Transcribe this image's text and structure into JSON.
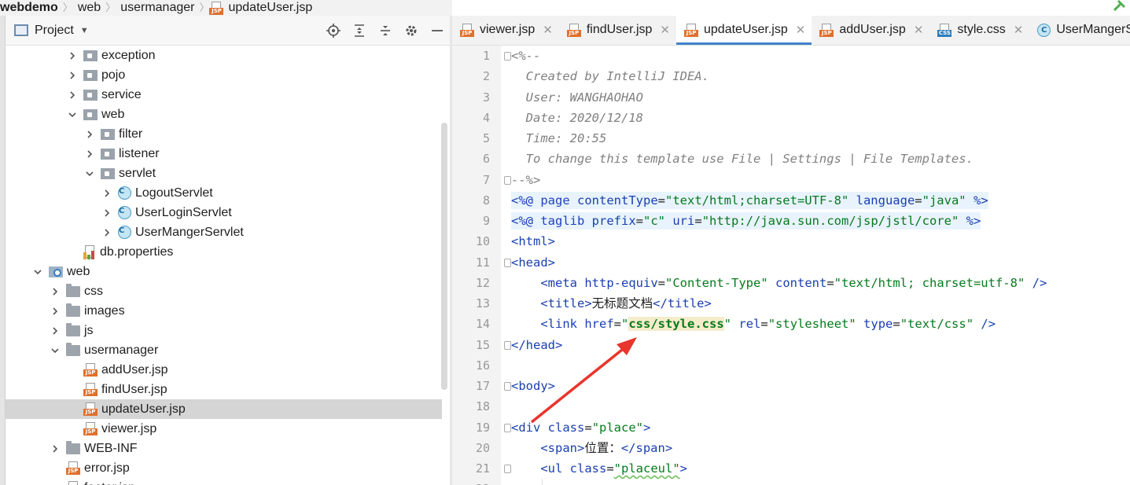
{
  "breadcrumb": [
    "webdemo",
    "web",
    "usermanager",
    "updateUser.jsp"
  ],
  "breadcrumb_file_icon": "jsp-file-icon",
  "project_panel": {
    "title": "Project",
    "tools": [
      "locate-icon",
      "expand-all-icon",
      "collapse-all-icon",
      "settings-gear-icon",
      "minimize-icon"
    ]
  },
  "tree": [
    {
      "label": "exception",
      "indent": 3,
      "icon": "package",
      "arrow": "right"
    },
    {
      "label": "pojo",
      "indent": 3,
      "icon": "package",
      "arrow": "right"
    },
    {
      "label": "service",
      "indent": 3,
      "icon": "package",
      "arrow": "right"
    },
    {
      "label": "web",
      "indent": 3,
      "icon": "package",
      "arrow": "down"
    },
    {
      "label": "filter",
      "indent": 4,
      "icon": "package",
      "arrow": "right"
    },
    {
      "label": "listener",
      "indent": 4,
      "icon": "package",
      "arrow": "right"
    },
    {
      "label": "servlet",
      "indent": 4,
      "icon": "package",
      "arrow": "down"
    },
    {
      "label": "LogoutServlet",
      "indent": 5,
      "icon": "class",
      "arrow": "right"
    },
    {
      "label": "UserLoginServlet",
      "indent": 5,
      "icon": "class",
      "arrow": "right"
    },
    {
      "label": "UserMangerServlet",
      "indent": 5,
      "icon": "class",
      "arrow": "right"
    },
    {
      "label": "db.properties",
      "indent": 3,
      "icon": "properties",
      "arrow": "none"
    },
    {
      "label": "web",
      "indent": 1,
      "icon": "web-folder",
      "arrow": "down"
    },
    {
      "label": "css",
      "indent": 2,
      "icon": "folder",
      "arrow": "right"
    },
    {
      "label": "images",
      "indent": 2,
      "icon": "folder",
      "arrow": "right"
    },
    {
      "label": "js",
      "indent": 2,
      "icon": "folder",
      "arrow": "right"
    },
    {
      "label": "usermanager",
      "indent": 2,
      "icon": "folder",
      "arrow": "down"
    },
    {
      "label": "addUser.jsp",
      "indent": 3,
      "icon": "jsp",
      "arrow": "none"
    },
    {
      "label": "findUser.jsp",
      "indent": 3,
      "icon": "jsp",
      "arrow": "none"
    },
    {
      "label": "updateUser.jsp",
      "indent": 3,
      "icon": "jsp",
      "arrow": "none",
      "selected": true
    },
    {
      "label": "viewer.jsp",
      "indent": 3,
      "icon": "jsp",
      "arrow": "none"
    },
    {
      "label": "WEB-INF",
      "indent": 2,
      "icon": "folder",
      "arrow": "right"
    },
    {
      "label": "error.jsp",
      "indent": 2,
      "icon": "jsp",
      "arrow": "none"
    },
    {
      "label": "footer.jsp",
      "indent": 2,
      "icon": "jsp",
      "arrow": "none"
    }
  ],
  "tabs": [
    {
      "label": "viewer.jsp",
      "icon": "jsp"
    },
    {
      "label": "findUser.jsp",
      "icon": "jsp"
    },
    {
      "label": "updateUser.jsp",
      "icon": "jsp",
      "active": true
    },
    {
      "label": "addUser.jsp",
      "icon": "jsp"
    },
    {
      "label": "style.css",
      "icon": "css"
    },
    {
      "label": "UserMangerServlet",
      "icon": "class"
    }
  ],
  "code": [
    [
      [
        "c",
        "<%--"
      ]
    ],
    [
      [
        "c",
        "  Created by IntelliJ IDEA."
      ]
    ],
    [
      [
        "c",
        "  User: WANGHAOHAO"
      ]
    ],
    [
      [
        "c",
        "  Date: 2020/12/18"
      ]
    ],
    [
      [
        "c",
        "  Time: 20:55"
      ]
    ],
    [
      [
        "c",
        "  To change this template use File | Settings | File Templates."
      ]
    ],
    [
      [
        "c",
        "--%>"
      ]
    ],
    [
      [
        "hl-mk",
        "<%@ "
      ],
      [
        "hl-ks",
        "page "
      ],
      [
        "hl-at",
        "contentType"
      ],
      [
        "hl-tx",
        "="
      ],
      [
        "hl-st",
        "\"text/html;charset=UTF-8\""
      ],
      [
        "hl-tx",
        " "
      ],
      [
        "hl-at",
        "language"
      ],
      [
        "hl-tx",
        "="
      ],
      [
        "hl-st",
        "\"java\""
      ],
      [
        "hl-tx",
        " "
      ],
      [
        "hl-mk",
        "%>"
      ]
    ],
    [
      [
        "hl-mk",
        "<%@ "
      ],
      [
        "hl-ks",
        "taglib "
      ],
      [
        "hl-at",
        "prefix"
      ],
      [
        "hl-tx",
        "="
      ],
      [
        "hl-st",
        "\"c\""
      ],
      [
        "hl-tx",
        " "
      ],
      [
        "hl-at",
        "uri"
      ],
      [
        "hl-tx",
        "="
      ],
      [
        "hl-st",
        "\"http://java.sun.com/jsp/jstl/core\""
      ],
      [
        "hl-tx",
        " "
      ],
      [
        "hl-mk",
        "%>"
      ]
    ],
    [
      [
        "tg",
        "<html>"
      ]
    ],
    [
      [
        "tg",
        "<head>"
      ]
    ],
    [
      [
        "tx",
        "    "
      ],
      [
        "tg",
        "<meta "
      ],
      [
        "at",
        "http-equiv"
      ],
      [
        "tx",
        "="
      ],
      [
        "st",
        "\"Content-Type\""
      ],
      [
        "tx",
        " "
      ],
      [
        "at",
        "content"
      ],
      [
        "tx",
        "="
      ],
      [
        "st",
        "\"text/html; charset=utf-8\""
      ],
      [
        "tx",
        " "
      ],
      [
        "tg",
        "/>"
      ]
    ],
    [
      [
        "tx",
        "    "
      ],
      [
        "tg",
        "<title>"
      ],
      [
        "tx",
        "无标题文档"
      ],
      [
        "tg",
        "</title>"
      ]
    ],
    [
      [
        "tx",
        "    "
      ],
      [
        "tg",
        "<link "
      ],
      [
        "at",
        "href"
      ],
      [
        "tx",
        "="
      ],
      [
        "st",
        "\""
      ],
      [
        "css-hl",
        "css/style.css"
      ],
      [
        "st",
        "\""
      ],
      [
        "tx",
        " "
      ],
      [
        "at",
        "rel"
      ],
      [
        "tx",
        "="
      ],
      [
        "st",
        "\"stylesheet\""
      ],
      [
        "tx",
        " "
      ],
      [
        "at",
        "type"
      ],
      [
        "tx",
        "="
      ],
      [
        "st",
        "\"text/css\""
      ],
      [
        "tx",
        " "
      ],
      [
        "tg",
        "/>"
      ]
    ],
    [
      [
        "tg",
        "</head>"
      ]
    ],
    [],
    [
      [
        "tg",
        "<body>"
      ]
    ],
    [],
    [
      [
        "tg",
        "<div "
      ],
      [
        "at",
        "class"
      ],
      [
        "tx",
        "="
      ],
      [
        "st",
        "\"place\""
      ],
      [
        "tg",
        ">"
      ]
    ],
    [
      [
        "tx",
        "    "
      ],
      [
        "tg",
        "<span>"
      ],
      [
        "tx",
        "位置："
      ],
      [
        "tg",
        "</span>"
      ]
    ],
    [
      [
        "tx",
        "    "
      ],
      [
        "tg",
        "<ul "
      ],
      [
        "at",
        "class"
      ],
      [
        "tx",
        "="
      ],
      [
        "st",
        "\"placeul\""
      ],
      [
        "tg",
        ">"
      ]
    ]
  ],
  "folded_lines": [
    1,
    7,
    11,
    15,
    17,
    19,
    21
  ],
  "accent_color": "#4083c9",
  "arrow_color": "#e8352e"
}
